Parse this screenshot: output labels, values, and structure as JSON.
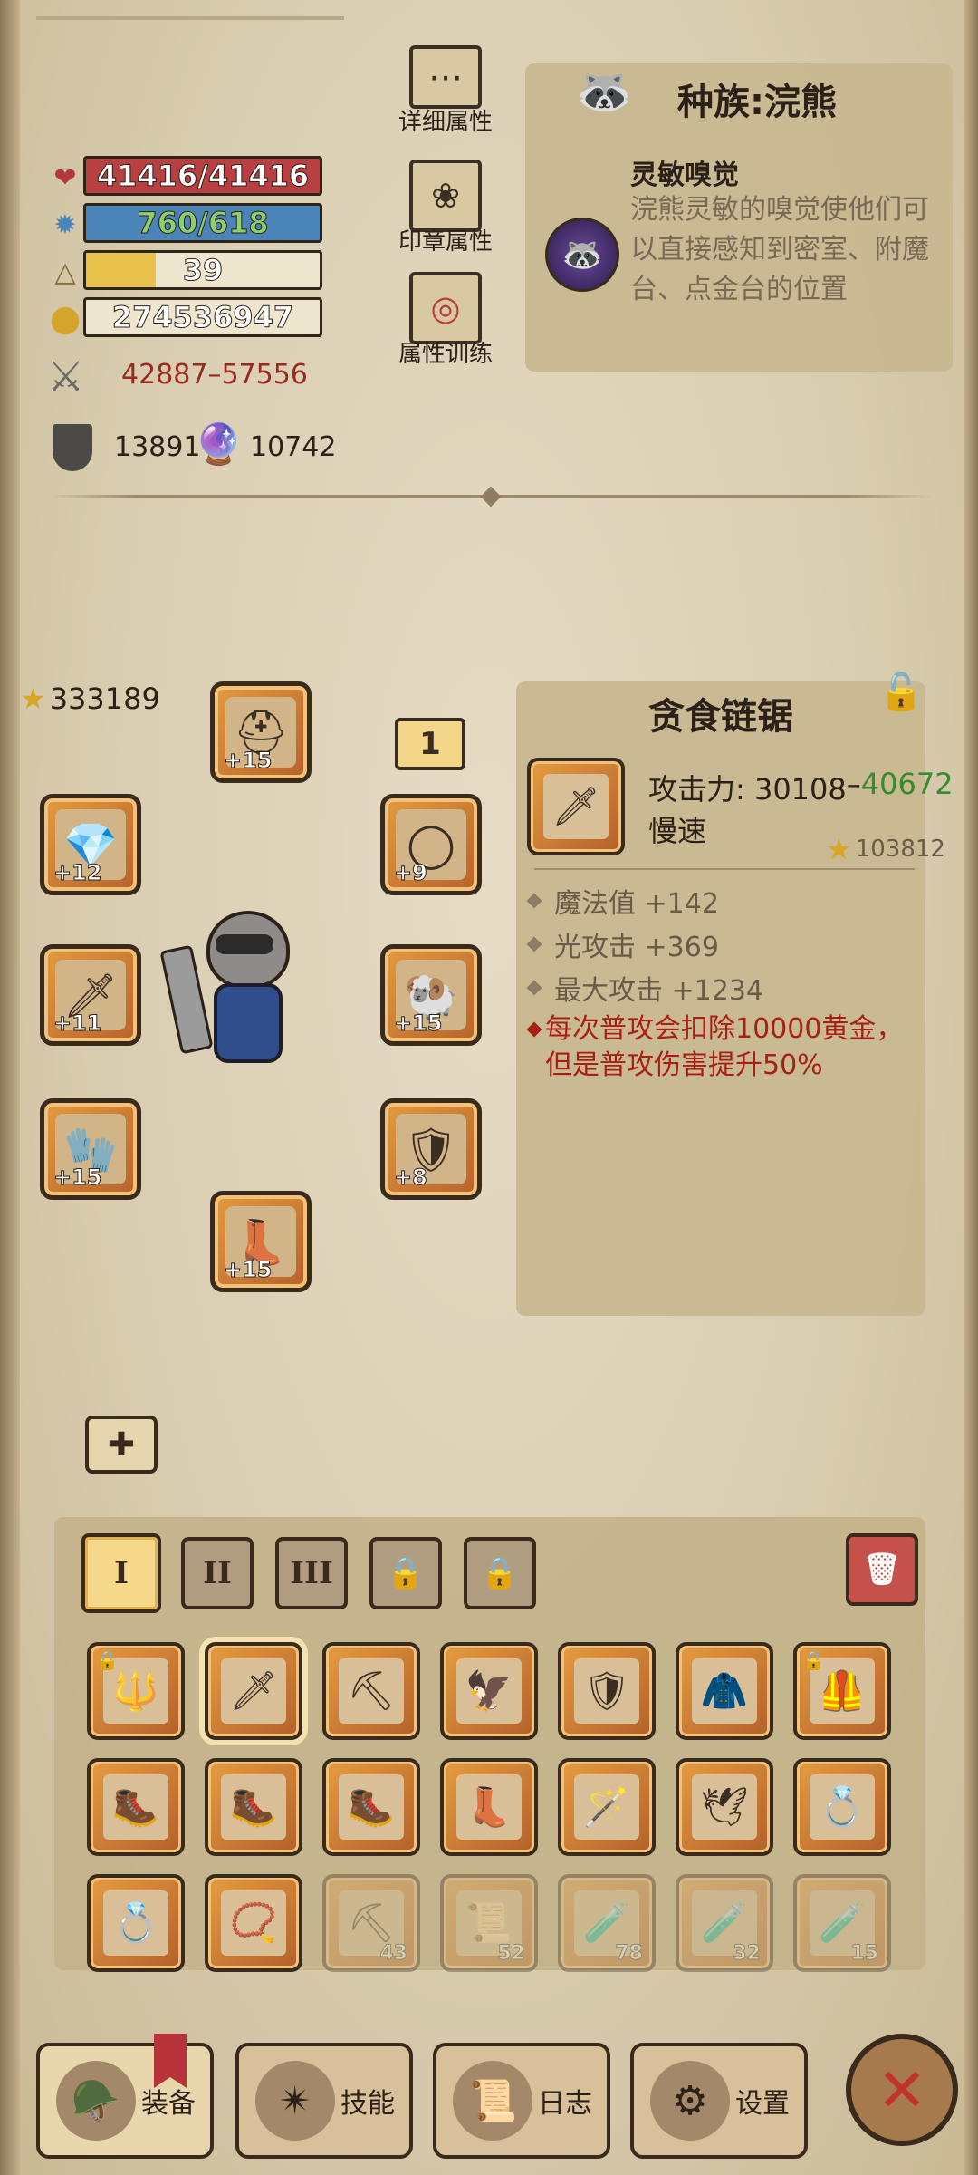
{
  "stats": {
    "hp": {
      "text": "41416/41416",
      "fill": 1.0,
      "color": "#b84040",
      "icon": "heart-icon"
    },
    "mp": {
      "text": "760/618",
      "fill": 1.0,
      "color": "#4a84b8",
      "icon": "gear-mana-icon"
    },
    "level": {
      "text": "39",
      "fill": 0.3,
      "color": "#e8c24a",
      "icon": "triangle-icon"
    },
    "gold": {
      "text": "274536947",
      "fill": 0.0,
      "color": "#e9dfc6",
      "icon": "gold-coins-icon"
    },
    "attack": "42887",
    "attack_sep": "–",
    "attack_max": "57556",
    "defense": "13891",
    "magic": "10742"
  },
  "side_buttons": {
    "detail": "详细属性",
    "seal": "印章属性",
    "train": "属性训练"
  },
  "race": {
    "title": "种族:浣熊",
    "skill_name": "灵敏嗅觉",
    "skill_desc": "浣熊灵敏的嗅觉使他们可以直接感知到密室、附魔台、点金台的位置"
  },
  "equipment": {
    "star_total": "333189",
    "set_badge": "1",
    "slots": [
      {
        "name": "slot-head",
        "level": "+15",
        "icon": "⛑"
      },
      {
        "name": "slot-amulet",
        "level": "+12",
        "icon": "💎"
      },
      {
        "name": "slot-ring",
        "level": "+9",
        "icon": "◯"
      },
      {
        "name": "slot-weapon",
        "level": "+11",
        "icon": "🗡"
      },
      {
        "name": "slot-shoulder",
        "level": "+15",
        "icon": "🐏"
      },
      {
        "name": "slot-gloves",
        "level": "+15",
        "icon": "🧤"
      },
      {
        "name": "slot-armor",
        "level": "+8",
        "icon": "🛡"
      },
      {
        "name": "slot-boots",
        "level": "+15",
        "icon": "👢"
      }
    ]
  },
  "item": {
    "name": "贪食链锯",
    "attack_label": "攻击力: 30108",
    "attack_sep": "–",
    "attack_max": "40672",
    "speed": "慢速",
    "stars": "103812",
    "props": [
      "魔法值 +142",
      "光攻击 +369",
      "最大攻击 +1234"
    ],
    "special": "每次普攻会扣除10000黄金，但是普攻伤害提升50%"
  },
  "tabs": [
    "I",
    "II",
    "III",
    "🔒",
    "🔒"
  ],
  "inventory": [
    {
      "icon": "🔱",
      "locked": true,
      "count": "",
      "faded": false
    },
    {
      "icon": "🗡",
      "locked": false,
      "count": "",
      "faded": false,
      "selected": true
    },
    {
      "icon": "⛏",
      "locked": false,
      "count": "",
      "faded": false
    },
    {
      "icon": "🦅",
      "locked": false,
      "count": "",
      "faded": false
    },
    {
      "icon": "🛡",
      "locked": false,
      "count": "",
      "faded": false
    },
    {
      "icon": "🧥",
      "locked": false,
      "count": "",
      "faded": false
    },
    {
      "icon": "🦺",
      "locked": true,
      "count": "",
      "faded": false
    },
    {
      "icon": "🥾",
      "locked": false,
      "count": "",
      "faded": false
    },
    {
      "icon": "🥾",
      "locked": false,
      "count": "",
      "faded": false
    },
    {
      "icon": "🥾",
      "locked": false,
      "count": "",
      "faded": false
    },
    {
      "icon": "👢",
      "locked": false,
      "count": "",
      "faded": false
    },
    {
      "icon": "🪄",
      "locked": false,
      "count": "",
      "faded": false
    },
    {
      "icon": "🕊",
      "locked": false,
      "count": "",
      "faded": false
    },
    {
      "icon": "💍",
      "locked": false,
      "count": "",
      "faded": false
    },
    {
      "icon": "💍",
      "locked": false,
      "count": "",
      "faded": false
    },
    {
      "icon": "📿",
      "locked": false,
      "count": "",
      "faded": false
    },
    {
      "icon": "⛏",
      "locked": false,
      "count": "43",
      "faded": true
    },
    {
      "icon": "📜",
      "locked": false,
      "count": "52",
      "faded": true
    },
    {
      "icon": "🧪",
      "locked": false,
      "count": "78",
      "faded": true
    },
    {
      "icon": "🧪",
      "locked": false,
      "count": "32",
      "faded": true
    },
    {
      "icon": "🧪",
      "locked": false,
      "count": "15",
      "faded": true
    }
  ],
  "nav": {
    "equip": "装备",
    "skills": "技能",
    "log": "日志",
    "settings": "设置"
  }
}
